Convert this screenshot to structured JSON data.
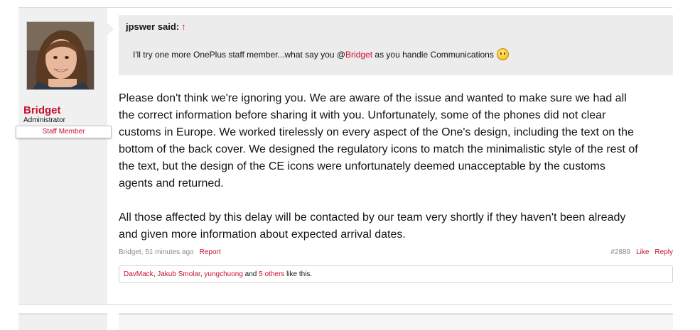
{
  "author": {
    "name": "Bridget",
    "title": "Administrator",
    "badge": "Staff Member"
  },
  "quote": {
    "author": "jpswer",
    "said_suffix": "said:",
    "arrow": "↑",
    "text_before": "I'll try one more OnePlus staff member...what say you @",
    "mention": "Bridget",
    "text_after": " as you handle Communications",
    "smiley_icon": "confused-smiley-icon"
  },
  "message": {
    "paragraph1_lines": [
      "Please don't think we're ignoring you. We are aware of the issue and wanted to make sure we had all",
      "the correct information before sharing it with you. Unfortunately, some of the phones did not clear",
      "customs in Europe. We worked tirelessly on every aspect of the One's design, including the text on the",
      "bottom of the back cover. We designed the regulatory icons to match the minimalistic style of the rest of",
      "the text, but the design of the CE icons were unfortunately deemed unacceptable by the customs",
      "agents and returned."
    ],
    "paragraph2_lines": [
      "All those affected by this delay will be contacted by our team very shortly if they haven't been already",
      "and given more information about expected arrival dates."
    ]
  },
  "meta": {
    "byline": "Bridget, 51 minutes ago",
    "report_label": "Report",
    "post_number": "#2889",
    "like_label": "Like",
    "reply_label": "Reply"
  },
  "likes": {
    "users": [
      "DavMack",
      "Jakub Smolar",
      "yungchuong"
    ],
    "separator": ", ",
    "and_text": " and ",
    "others_label": "5 others",
    "suffix": " like this."
  },
  "colors": {
    "accent": "#c8102e",
    "sidebar_bg": "#f0f0f0",
    "quote_bg": "#ececec"
  }
}
